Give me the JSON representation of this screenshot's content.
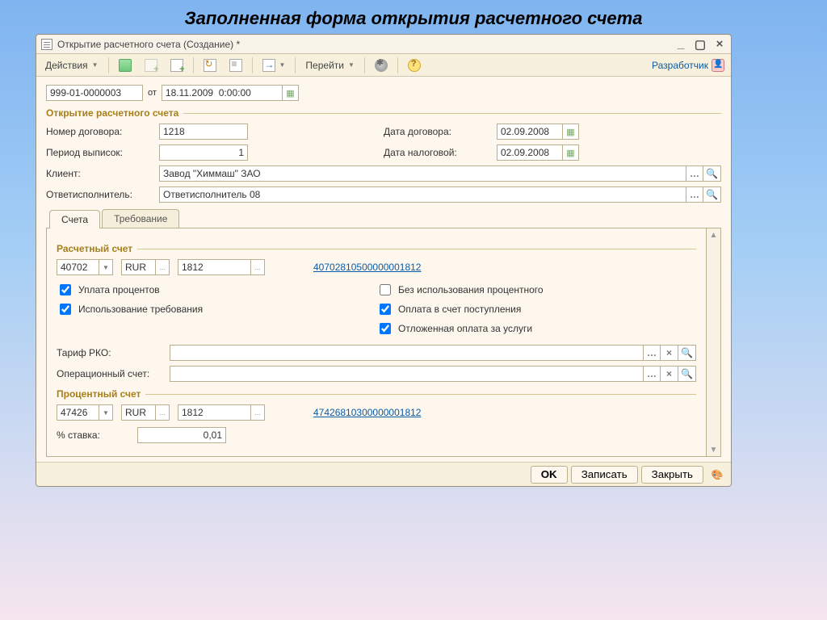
{
  "page": {
    "slideTitle": "Заполненная форма открытия расчетного счета"
  },
  "window": {
    "title": "Открытие расчетного счета (Создание) *"
  },
  "toolbar": {
    "actions": "Действия",
    "goTo": "Перейти",
    "developer": "Разработчик"
  },
  "header": {
    "docNumber": "999-01-0000003",
    "dateLabel": "от",
    "dateTime": "18.11.2009  0:00:00"
  },
  "openSection": {
    "title": "Открытие расчетного счета",
    "contractNoLabel": "Номер договора:",
    "contractNo": "1218",
    "contractDateLabel": "Дата договора:",
    "contractDate": "02.09.2008",
    "periodLabel": "Период выписок:",
    "period": "1",
    "taxDateLabel": "Дата налоговой:",
    "taxDate": "02.09.2008",
    "clientLabel": "Клиент:",
    "client": "Завод \"Химмаш\" ЗАО",
    "executorLabel": "Ответисполнитель:",
    "executor": "Ответисполнитель 08"
  },
  "tabs": {
    "accounts": "Счета",
    "requirement": "Требование"
  },
  "settlement": {
    "title": "Расчетный счет",
    "code": "40702",
    "currency": "RUR",
    "number": "1812",
    "fullNumber": "40702810500000001812",
    "payInterest": "Уплата процентов",
    "noPercent": "Без использования процентного",
    "useRequirement": "Использование требования",
    "payOnReceipt": "Оплата в счет поступления",
    "deferredPay": "Отложенная оплата за услуги",
    "tariffLabel": "Тариф РКО:",
    "tariff": "",
    "opAcctLabel": "Операционный счет:",
    "opAcct": ""
  },
  "percent": {
    "title": "Процентный счет",
    "code": "47426",
    "currency": "RUR",
    "number": "1812",
    "fullNumber": "47426810300000001812",
    "rateLabel": "% ставка:",
    "rate": "0,01"
  },
  "footer": {
    "ok": "OK",
    "save": "Записать",
    "close": "Закрыть"
  }
}
